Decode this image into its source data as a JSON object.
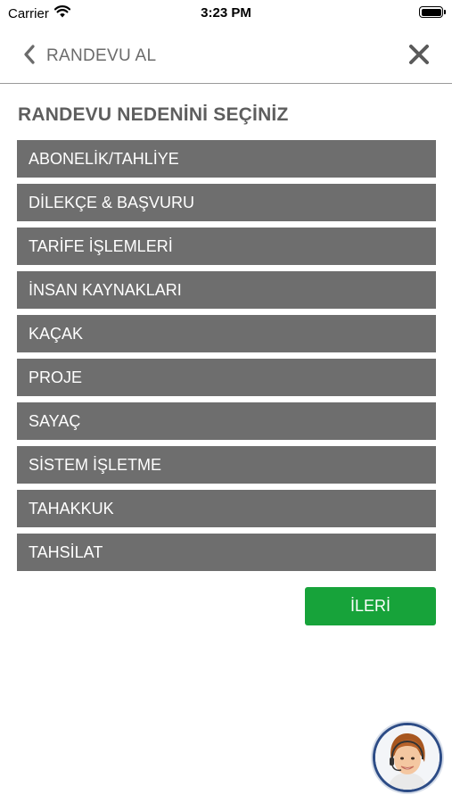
{
  "status_bar": {
    "carrier": "Carrier",
    "time": "3:23 PM",
    "icons": [
      "wifi-icon",
      "battery-icon"
    ]
  },
  "header": {
    "back_label": "RANDEVU AL",
    "back_icon": "chevron-left-icon",
    "close_icon": "close-icon"
  },
  "main": {
    "title": "RANDEVU NEDENİNİ SEÇİNİZ",
    "reasons": [
      "ABONELİK/TAHLİYE",
      "DİLEKÇE & BAŞVURU",
      "TARİFE İŞLEMLERİ",
      "İNSAN KAYNAKLARI",
      "KAÇAK",
      "PROJE",
      "SAYAÇ",
      "SİSTEM İŞLETME",
      "TAHAKKUK",
      "TAHSİLAT"
    ],
    "next_label": "İLERİ"
  },
  "support": {
    "icon": "support-agent-avatar-icon"
  },
  "colors": {
    "item_bg": "#6e6e6e",
    "accent_green": "#17a33a",
    "title_text": "#5e5e5e",
    "avatar_ring": "#2d4c86"
  }
}
